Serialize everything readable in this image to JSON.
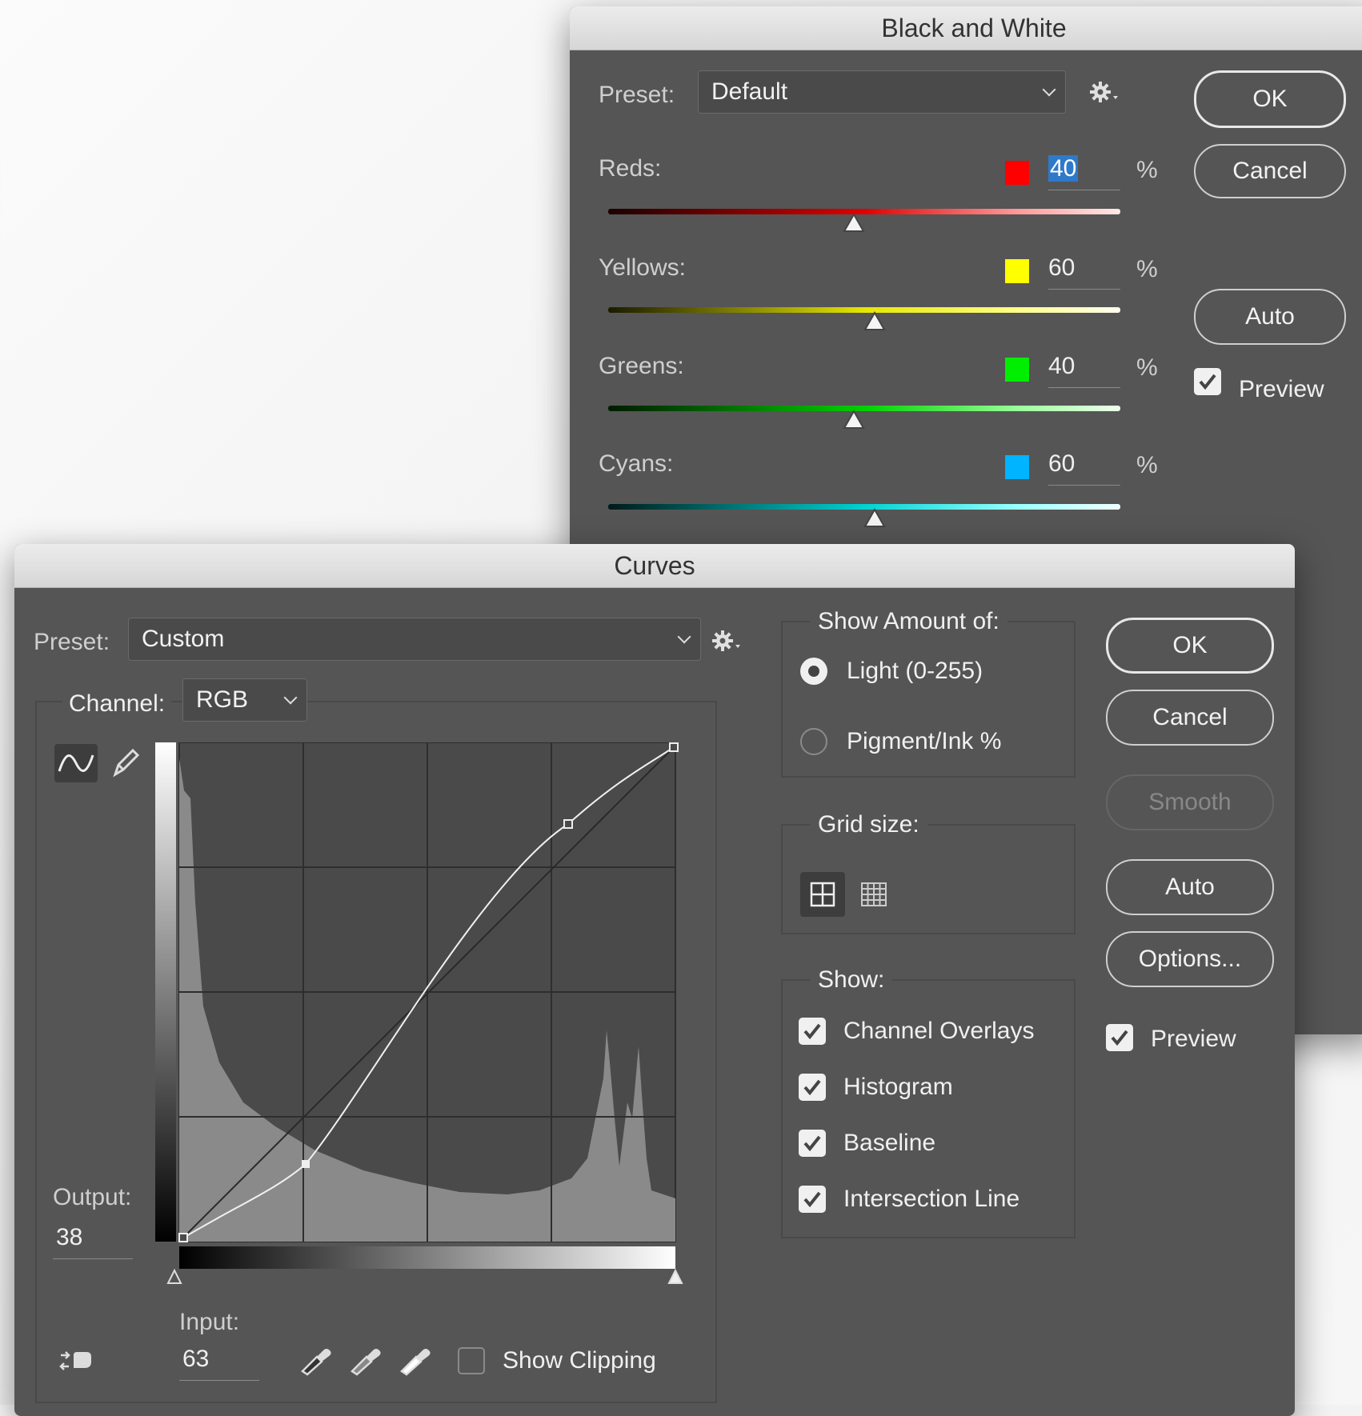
{
  "bw": {
    "title": "Black and White",
    "preset_label": "Preset:",
    "preset_value": "Default",
    "gear_icon": "gear-icon",
    "sliders": [
      {
        "label": "Reds:",
        "value": "40",
        "unit": "%",
        "color": "#ff0000",
        "grad": "linear-gradient(90deg,#1a0000,#e00000 50%,#ff9a9a 80%,#ffe9e9)",
        "level": 0.48
      },
      {
        "label": "Yellows:",
        "value": "60",
        "unit": "%",
        "color": "#ffff00",
        "grad": "linear-gradient(90deg,#1a1a00,#e6e600 50%,#ffff8a 80%,#fffff0)",
        "level": 0.52
      },
      {
        "label": "Greens:",
        "value": "40",
        "unit": "%",
        "color": "#00ee00",
        "grad": "linear-gradient(90deg,#001a00,#00d000 50%,#9aff9a 80%,#eeffee)",
        "level": 0.48
      },
      {
        "label": "Cyans:",
        "value": "60",
        "unit": "%",
        "color": "#00b4ff",
        "grad": "linear-gradient(90deg,#001a1a,#00d2d2 50%,#9affff 80%,#f0ffff)",
        "level": 0.52
      }
    ],
    "buttons": {
      "ok": "OK",
      "cancel": "Cancel",
      "auto": "Auto"
    },
    "preview_label": "Preview",
    "preview_checked": true
  },
  "curves": {
    "title": "Curves",
    "preset_label": "Preset:",
    "preset_value": "Custom",
    "channel_label": "Channel:",
    "channel_value": "RGB",
    "output_label": "Output:",
    "output_value": "38",
    "input_label": "Input:",
    "input_value": "63",
    "show_clipping_label": "Show Clipping",
    "show_clipping_checked": false,
    "show_amount": {
      "title": "Show Amount of:",
      "options": [
        {
          "label": "Light  (0-255)",
          "selected": true
        },
        {
          "label": "Pigment/Ink %",
          "selected": false
        }
      ]
    },
    "grid_size": {
      "title": "Grid size:",
      "selected": "simple"
    },
    "show": {
      "title": "Show:",
      "items": [
        {
          "label": "Channel Overlays",
          "checked": true
        },
        {
          "label": "Histogram",
          "checked": true
        },
        {
          "label": "Baseline",
          "checked": true
        },
        {
          "label": "Intersection Line",
          "checked": true
        }
      ]
    },
    "buttons": {
      "ok": "OK",
      "cancel": "Cancel",
      "smooth": "Smooth",
      "auto": "Auto",
      "options": "Options..."
    },
    "preview_label": "Preview",
    "preview_checked": true
  }
}
